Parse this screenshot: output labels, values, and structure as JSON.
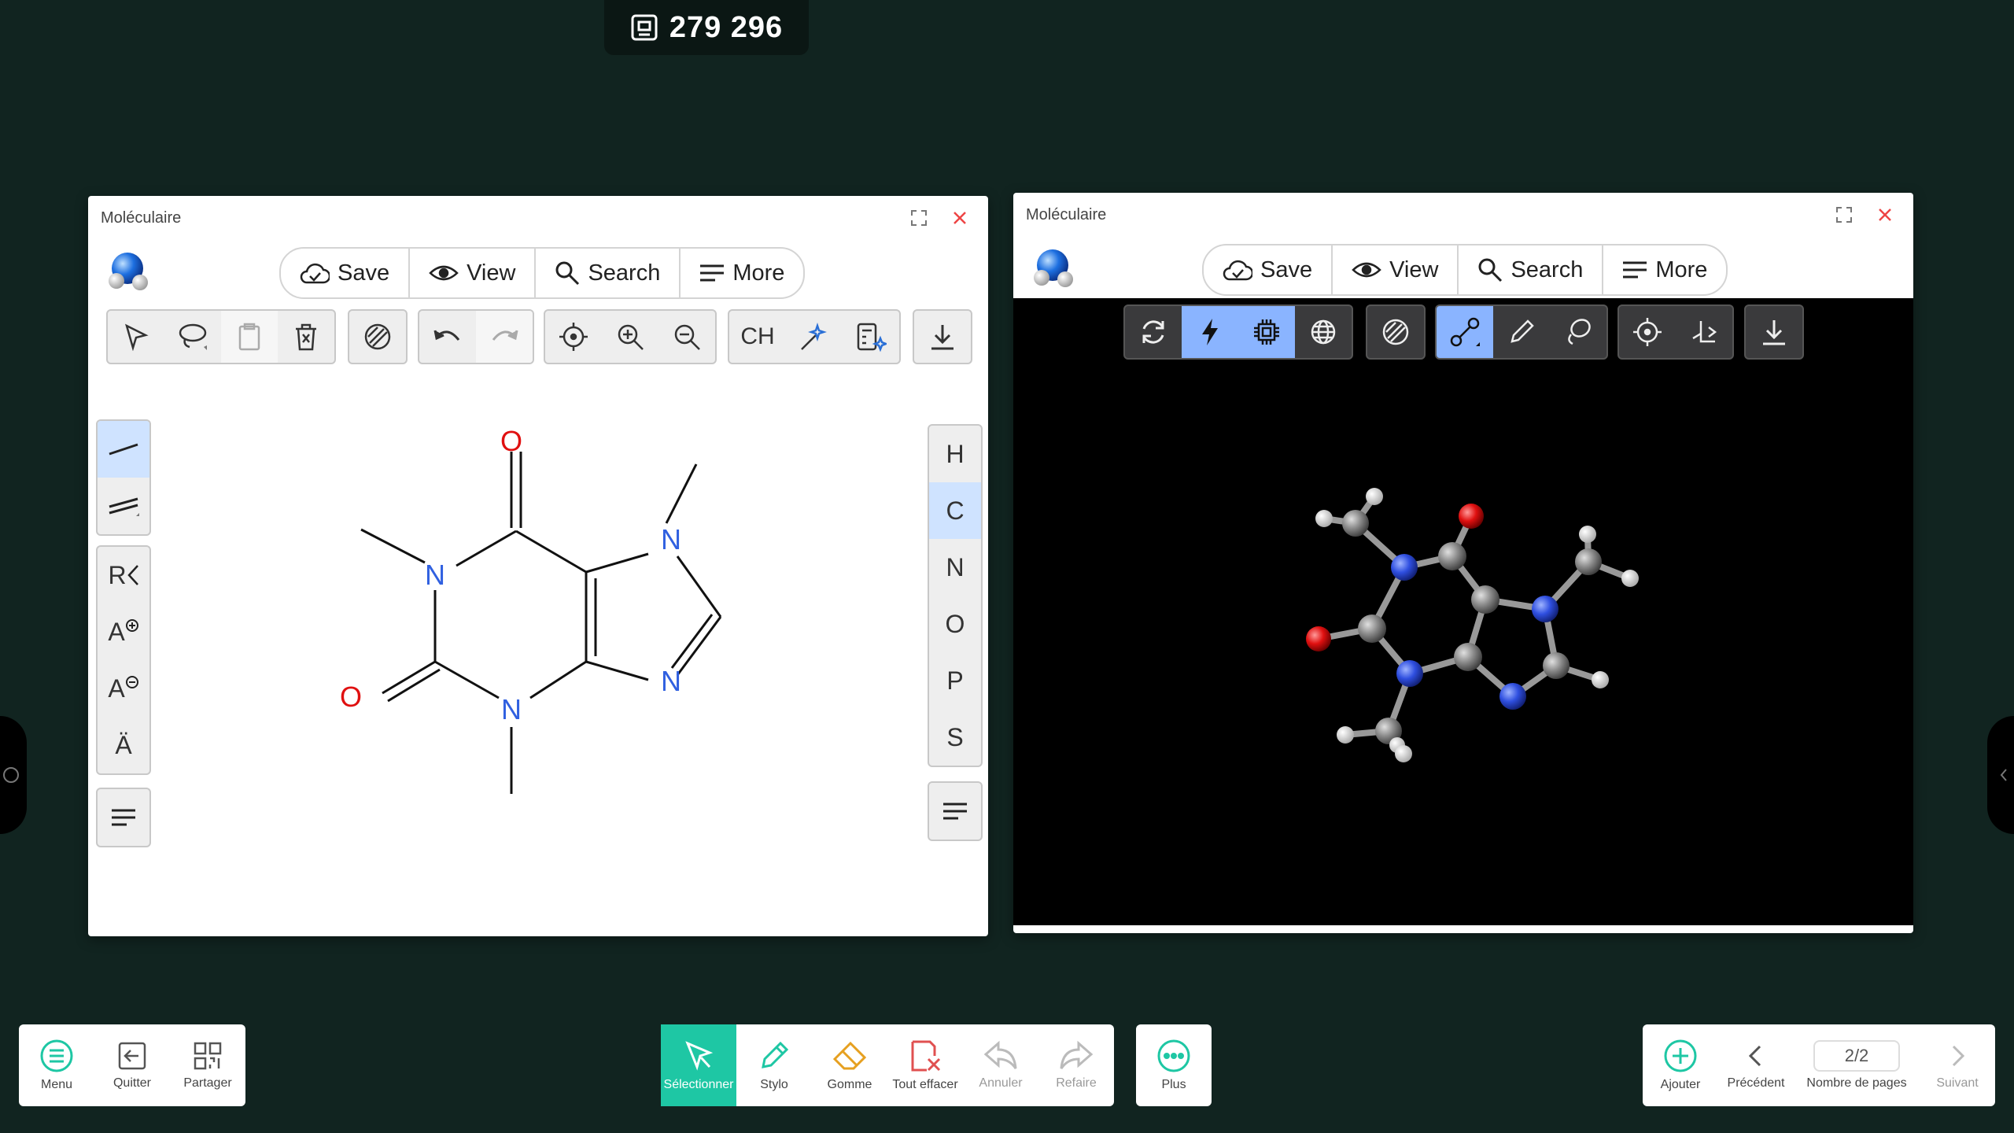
{
  "session": {
    "code": "279 296"
  },
  "left_window": {
    "title": "Moléculaire",
    "menu": {
      "save": "Save",
      "view": "View",
      "search": "Search",
      "more": "More"
    },
    "toolbar": {
      "ch_label": "CH"
    },
    "left_tools": {
      "r_group": "R",
      "charge_plus": "A",
      "charge_minus": "A",
      "lone_pair": "Ä"
    },
    "elements": [
      "H",
      "C",
      "N",
      "O",
      "P",
      "S"
    ],
    "selected_element": "C",
    "molecule": {
      "atoms": {
        "o_top": "O",
        "o_left": "O",
        "n1": "N",
        "n3": "N",
        "n7": "N",
        "n9": "N"
      }
    }
  },
  "right_window": {
    "title": "Moléculaire",
    "menu": {
      "save": "Save",
      "view": "View",
      "search": "Search",
      "more": "More"
    }
  },
  "bottom_left": {
    "menu": "Menu",
    "quit": "Quitter",
    "share": "Partager"
  },
  "bottom_center": {
    "select": "Sélectionner",
    "pen": "Stylo",
    "eraser": "Gomme",
    "clear": "Tout effacer",
    "undo": "Annuler",
    "redo": "Refaire"
  },
  "bottom_more": {
    "more": "Plus"
  },
  "bottom_right": {
    "add": "Ajouter",
    "prev": "Précédent",
    "pages": "2/2",
    "pages_label": "Nombre de pages",
    "next": "Suivant"
  },
  "colors": {
    "background": "#112420",
    "accent": "#1ec7a4",
    "nitrogen": "#3060e0",
    "oxygen": "#e01010"
  }
}
